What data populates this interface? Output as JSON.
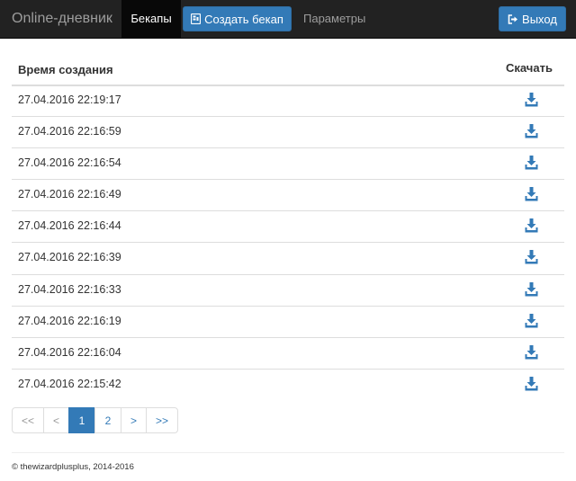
{
  "navbar": {
    "brand": "Online-дневник",
    "active_tab": "Бекапы",
    "create_button": "Создать бекап",
    "settings_link": "Параметры",
    "logout_button": "Выход"
  },
  "table": {
    "columns": [
      "Время создания",
      "Скачать"
    ],
    "rows": [
      "27.04.2016 22:19:17",
      "27.04.2016 22:16:59",
      "27.04.2016 22:16:54",
      "27.04.2016 22:16:49",
      "27.04.2016 22:16:44",
      "27.04.2016 22:16:39",
      "27.04.2016 22:16:33",
      "27.04.2016 22:16:19",
      "27.04.2016 22:16:04",
      "27.04.2016 22:15:42"
    ],
    "download_icon": "download-icon"
  },
  "pagination": {
    "first": "<<",
    "prev": "<",
    "pages": [
      "1",
      "2"
    ],
    "current": "1",
    "next": ">",
    "last": ">>"
  },
  "footer": {
    "text": "© thewizardplusplus, 2014-2016"
  },
  "colors": {
    "navbar": "#222222",
    "primary": "#337ab7",
    "border": "#dddddd"
  }
}
